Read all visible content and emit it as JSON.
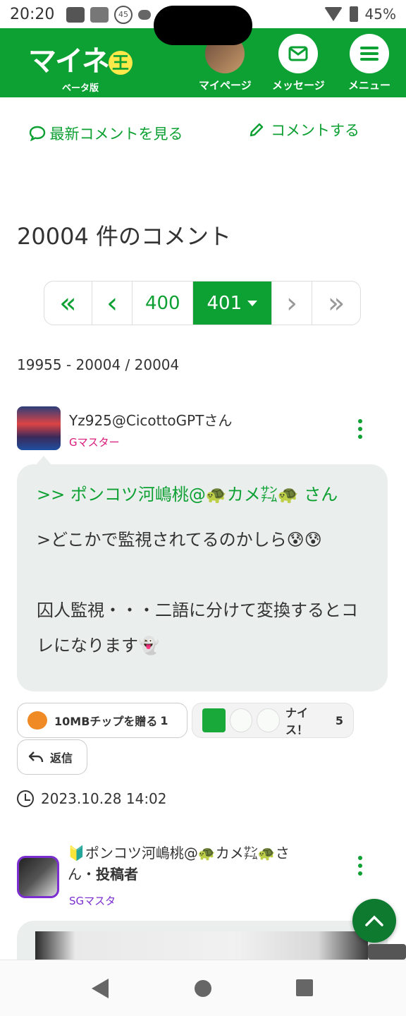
{
  "status_bar": {
    "time": "20:20",
    "badge_count": "45",
    "battery": "45%",
    "icons": [
      "youtube-icon",
      "wifi-alert-icon",
      "badge-icon",
      "cloud-icon",
      "wifi-icon",
      "battery-icon"
    ]
  },
  "header": {
    "logo_text": "マイネ",
    "logo_ball": "王",
    "logo_sub": "ベータ版",
    "nav": [
      {
        "label": "マイページ",
        "icon": "avatar"
      },
      {
        "label": "メッセージ",
        "icon": "mail-icon"
      },
      {
        "label": "メニュー",
        "icon": "menu-icon"
      }
    ]
  },
  "actions": {
    "latest_label": "最新コメントを見る",
    "comment_label": "コメントする"
  },
  "comment_count_title": "20004 件のコメント",
  "pagination": {
    "first": "«",
    "prev": "‹",
    "page_prev": "400",
    "page_current": "401",
    "next": "›",
    "last": "»"
  },
  "range_text": "19955 - 20004 / 20004",
  "comments": [
    {
      "user": "Yz925@CicottoGPTさん",
      "rank": "Gマスター",
      "reply_to": ">> ポンコツ河嶋桃@🐢カメ㌠🐢 さん",
      "quote": ">どこかで監視されてるのかしら😰😰",
      "body": "囚人監視・・・二語に分けて変換するとコレになります👻",
      "tip_label": "10MBチップを贈る",
      "tip_count": "1",
      "nice_label": "ナイス！",
      "nice_count": "5",
      "reply_label": "返信",
      "timestamp": "2023.10.28 14:02"
    },
    {
      "user_line1": "🔰ポンコツ河嶋桃@🐢カメ㌠🐢さ",
      "user_line2_a": "ん・",
      "user_line2_b": "投稿者",
      "rank": "SGマスタ"
    }
  ],
  "colors": {
    "brand_green": "#0da033",
    "rank_pink": "#d81b7a",
    "rank_purple": "#7b2fd0",
    "bubble_bg": "#eaeeec"
  }
}
